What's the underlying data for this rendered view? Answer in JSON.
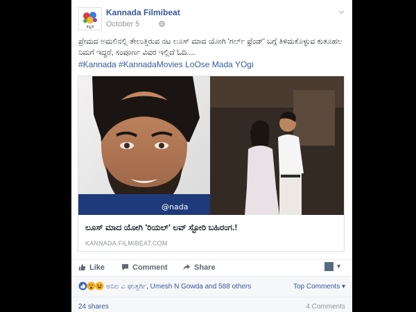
{
  "post": {
    "page_name": "Kannada Filmibeat",
    "date": "October 5",
    "avatar_label": "ಕನ್ನಡ",
    "text": "ಪ್ರೇಮದ ಅಮಲಿನಲ್ಲಿ ತೇಲುತ್ತಿರುವ ನಟ ಲೂಸ್ ಮಾದ ಯೋಗಿ 'ಗರ್ಲ್ ಫ್ರೆಂಡ್' ಬಗ್ಗೆ ತಿಳಿದುಕೊಳ್ಳುವ ಕುತೂಹಲ ನಿಮಗೆ ಇದ್ದರೆ, ಸಂಪೂರ್ಣ ವಿವರ ಇಲ್ಲಿದೆ ಓದಿ....",
    "hashtags": "#Kannada #KannadaMovies LoOse Mada YOgi"
  },
  "link": {
    "image_watermark": "@nada",
    "title": "ಲೂಸ್ ಮಾದ ಯೋಗಿ 'ರಿಯಲ್' ಲವ್ ಸ್ಟೋರಿ ಬಹಿರಂಗ.!",
    "domain": "KANNADA.FILMIBEAT.COM"
  },
  "actions": {
    "like": "Like",
    "comment": "Comment",
    "share": "Share"
  },
  "reactions": {
    "prefix": "ಅನಿಲ ಎ ಘುತ್ತರ್ಗಿ,",
    "summary": "Umesh N Gowda and 588 others",
    "top_comments": "Top Comments ▾"
  },
  "footer": {
    "shares": "24 shares",
    "comments": "4 Comments"
  },
  "colors": {
    "link_blue": "#365899",
    "muted": "#90949c",
    "like_blue": "#4267b2",
    "love_red": "#f25268",
    "haha_yellow": "#f7b125"
  }
}
